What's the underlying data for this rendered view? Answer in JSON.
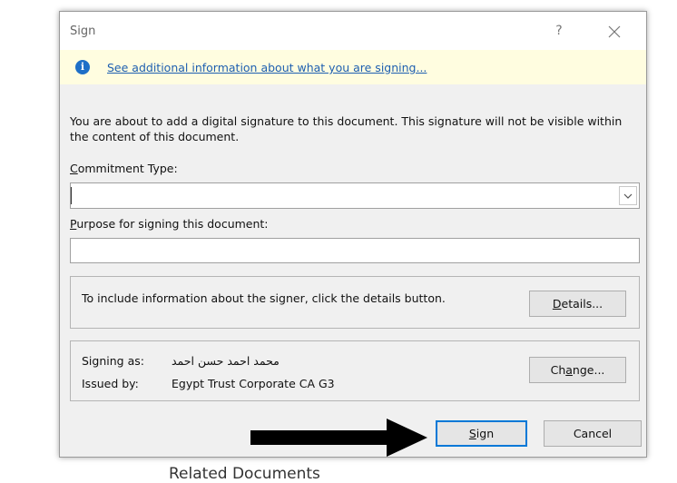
{
  "background": {
    "partial_text": "Related Documents"
  },
  "dialog": {
    "title": "Sign",
    "help_label": "?",
    "info_link": "See additional information about what you are signing...",
    "description": "You are about to add a digital signature to this document. This signature will not be visible within the content of this document.",
    "commitment_type": {
      "label_accel": "C",
      "label_rest": "ommitment Type:",
      "value": ""
    },
    "purpose": {
      "label_accel": "P",
      "label_rest": "urpose for signing this document:",
      "value": ""
    },
    "details_group": {
      "text": "To include information about the signer, click the details button.",
      "button_accel": "D",
      "button_rest": "etails..."
    },
    "signer_group": {
      "signing_as_label": "Signing as:",
      "signing_as_value": "محمد احمد حسن احمد",
      "issued_by_label": "Issued by:",
      "issued_by_value": "Egypt Trust Corporate CA G3",
      "change_pre": "Ch",
      "change_accel": "a",
      "change_post": "nge..."
    },
    "sign_button": {
      "accel": "S",
      "rest": "ign"
    },
    "cancel_button": "Cancel"
  },
  "colors": {
    "info_bar_bg": "#fffde0",
    "link": "#1e5fb0",
    "info_icon": "#1e6fc7",
    "dialog_bg": "#f0f0f0",
    "primary_border": "#0078d7",
    "arrow": "#000000"
  }
}
